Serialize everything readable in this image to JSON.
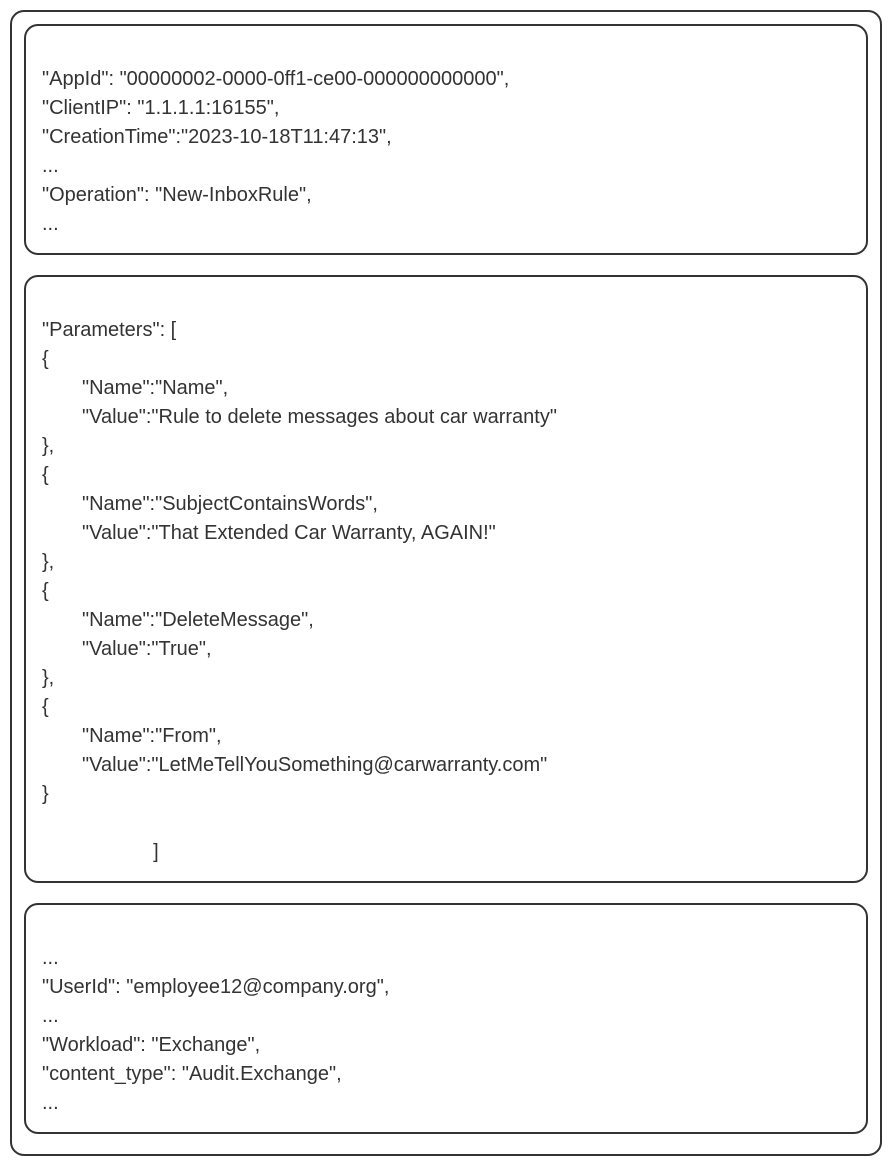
{
  "block1": {
    "l1": "\"AppId\": \"00000002-0000-0ff1-ce00-000000000000\",",
    "l2": "\"ClientIP\": \"1.1.1.1:16155\",",
    "l3": "\"CreationTime\":\"2023-10-18T11:47:13\",",
    "l4": "...",
    "l5": "\"Operation\": \"New-InboxRule\",",
    "l6": "..."
  },
  "block2": {
    "l1": "\"Parameters\": [",
    "l2": "{",
    "l3": "\"Name\":\"Name\",",
    "l4": "\"Value\":\"Rule to delete messages about car warranty\"",
    "l5": "},",
    "l6": "{",
    "l7": "\"Name\":\"SubjectContainsWords\",",
    "l8": "\"Value\":\"That Extended Car Warranty, AGAIN!\"",
    "l9": "},",
    "l10": "{",
    "l11": "\"Name\":\"DeleteMessage\",",
    "l12": "\"Value\":\"True\",",
    "l13": "},",
    "l14": "{",
    "l15": "\"Name\":\"From\",",
    "l16": "\"Value\":\"LetMeTellYouSomething@carwarranty.com\"",
    "l17": "}",
    "l18": "                    ]"
  },
  "block3": {
    "l1": "...",
    "l2": "\"UserId\": \"employee12@company.org\",",
    "l3": "...",
    "l4": "\"Workload\": \"Exchange\",",
    "l5": "\"content_type\": \"Audit.Exchange\",",
    "l6": "..."
  }
}
